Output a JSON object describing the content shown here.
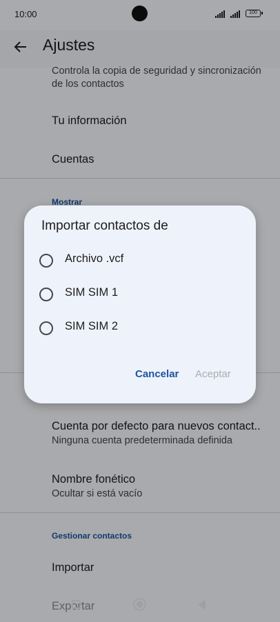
{
  "status": {
    "time": "10:00",
    "battery": "100"
  },
  "appbar": {
    "title": "Ajustes"
  },
  "settings": {
    "sync_desc_1": "Controla la copia de seguridad y sincronización",
    "sync_desc_2": "de los contactos",
    "your_info": "Tu información",
    "accounts": "Cuentas",
    "section_show": "Mostrar",
    "default_account_title": "Cuenta por defecto para nuevos contact..",
    "default_account_sub": "Ninguna cuenta predeterminada definida",
    "phonetic_title": "Nombre fonético",
    "phonetic_sub": "Ocultar si está vacío",
    "section_manage": "Gestionar contactos",
    "import": "Importar",
    "export": "Exportar"
  },
  "dialog": {
    "title": "Importar contactos de",
    "options": [
      "Archivo .vcf",
      "SIM SIM 1",
      "SIM SIM 2"
    ],
    "cancel": "Cancelar",
    "accept": "Aceptar"
  },
  "icons": [
    "back-arrow-icon",
    "signal-icon",
    "battery-icon",
    "recents-icon",
    "home-icon",
    "back-nav-icon"
  ]
}
